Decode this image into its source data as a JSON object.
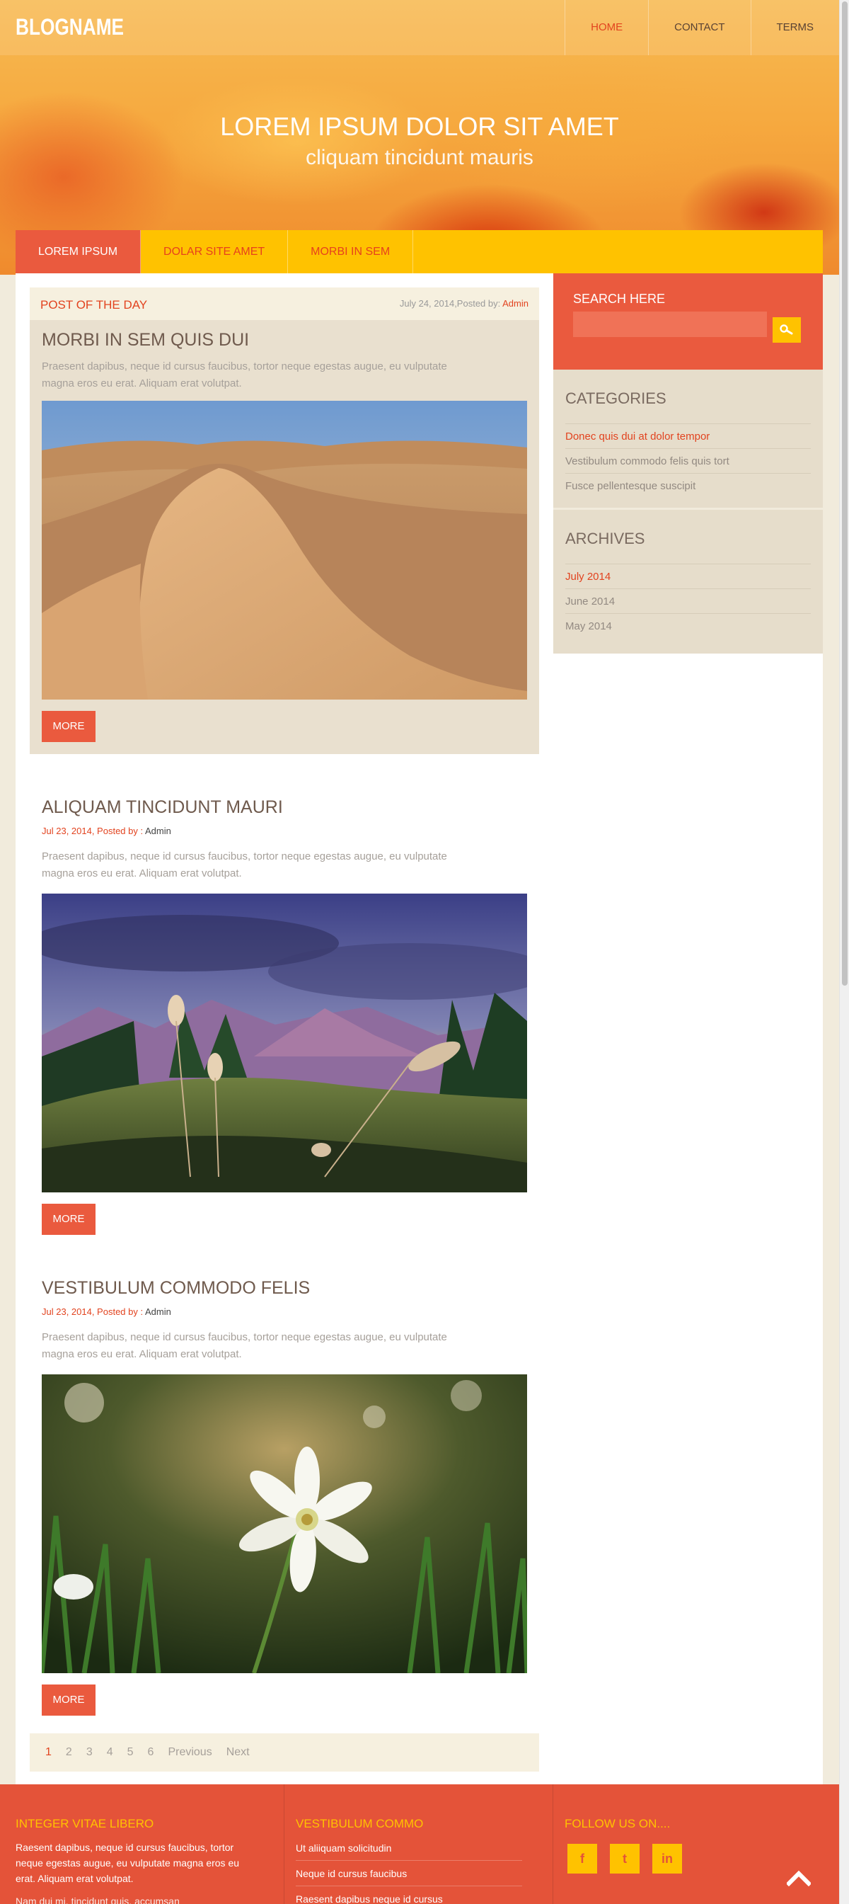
{
  "header": {
    "logo": "BLOGNAME",
    "nav": [
      "HOME",
      "CONTACT",
      "TERMS"
    ],
    "active_nav": "HOME",
    "hero_title": "LOREM IPSUM DOLOR SIT AMET",
    "hero_subtitle": "cliquam tincidunt mauris"
  },
  "subnav": {
    "items": [
      "LOREM IPSUM",
      "DOLAR SITE AMET",
      "MORBI IN SEM"
    ]
  },
  "post_of_day": {
    "label": "POST OF THE DAY",
    "date": "July 24, 2014,Posted by: ",
    "author": "Admin",
    "title": "MORBI IN SEM QUIS DUI",
    "excerpt": "Praesent dapibus, neque id cursus faucibus, tortor neque egestas augue, eu vulputate magna eros eu erat. Aliquam erat volutpat.",
    "more": "MORE"
  },
  "posts": [
    {
      "title": "ALIQUAM TINCIDUNT MAURI",
      "meta": "Jul 23, 2014, Posted by : ",
      "author": "Admin",
      "excerpt": "Praesent dapibus, neque id cursus faucibus, tortor neque egestas augue, eu vulputate magna eros eu erat. Aliquam erat volutpat.",
      "more": "MORE"
    },
    {
      "title": "VESTIBULUM COMMODO FELIS",
      "meta": "Jul 23, 2014, Posted by : ",
      "author": "Admin",
      "excerpt": "Praesent dapibus, neque id cursus faucibus, tortor neque egestas augue, eu vulputate magna eros eu erat. Aliquam erat volutpat.",
      "more": "MORE"
    }
  ],
  "pagination": {
    "pages": [
      "1",
      "2",
      "3",
      "4",
      "5",
      "6"
    ],
    "current": "1",
    "previous": "Previous",
    "next": "Next"
  },
  "sidebar": {
    "search_label": "SEARCH HERE",
    "search_placeholder": "",
    "categories_title": "CATEGORIES",
    "categories": [
      "Donec quis dui at dolor tempor",
      "Vestibulum commodo felis quis tort",
      "Fusce pellentesque suscipit"
    ],
    "archives_title": "ARCHIVES",
    "archives": [
      "July 2014",
      "June 2014",
      "May 2014"
    ]
  },
  "footer": {
    "col1_title": "INTEGER VITAE LIBERO",
    "col1_text": "Raesent dapibus, neque id cursus faucibus, tortor neque egestas augue, eu vulputate magna eros eu erat. Aliquam erat volutpat.",
    "col1_text2": "Nam dui mi, tincidunt quis, accumsan",
    "col2_title": "VESTIBULUM COMMO",
    "col2_links": [
      "Ut aliiquam solicitudin",
      "Neque id cursus faucibus",
      "Raesent dapibus neque id cursus"
    ],
    "col3_title": "FOLLOW US ON....",
    "social": [
      "f",
      "t",
      "in"
    ]
  },
  "colors": {
    "accent": "#ea5a3e",
    "yellow": "#ffc200",
    "footer": "#e45339"
  }
}
